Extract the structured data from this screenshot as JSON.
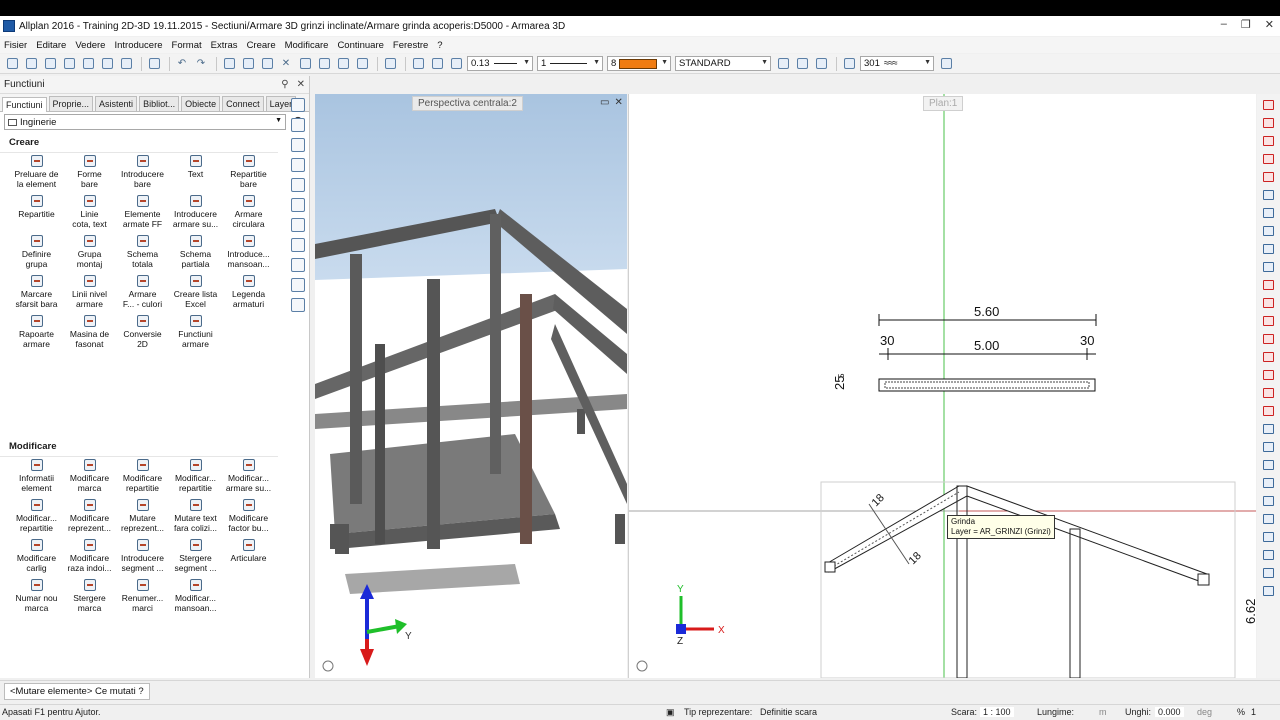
{
  "window": {
    "title": "Allplan 2016 - Training 2D-3D 19.11.2015 - Sectiuni/Armare 3D grinzi inclinate/Armare grinda acoperis:D5000 - Armarea 3D",
    "controls": [
      "–",
      "❐",
      "✕"
    ]
  },
  "menu": [
    "Fisier",
    "Editare",
    "Vedere",
    "Introducere",
    "Format",
    "Extras",
    "Creare",
    "Modificare",
    "Continuare",
    "Ferestre",
    "?"
  ],
  "toolbar": {
    "pen_value": "0.13",
    "line_value": "1",
    "color_value": "8",
    "color_hex": "#f07c12",
    "style_value": "STANDARD",
    "hatch_value": "301"
  },
  "panel": {
    "title": "Functiuni",
    "tabs": [
      "Functiuni",
      "Proprie...",
      "Asistenti",
      "Bibliot...",
      "Obiecte",
      "Connect",
      "Layer"
    ],
    "active_tab": "Functiuni",
    "category": "Inginerie",
    "create_group": {
      "title": "Creare",
      "items": [
        [
          "Preluare de",
          "la element"
        ],
        [
          "Forme",
          "bare"
        ],
        [
          "Introducere",
          "bare"
        ],
        [
          "Text",
          ""
        ],
        [
          "Repartitie",
          "bare"
        ],
        [
          "Repartitie",
          ""
        ],
        [
          "Linie",
          "cota, text"
        ],
        [
          "Elemente",
          "armate FF"
        ],
        [
          "Introducere",
          "armare su..."
        ],
        [
          "Armare",
          "circulara"
        ],
        [
          "Definire",
          "grupa"
        ],
        [
          "Grupa",
          "montaj"
        ],
        [
          "Schema",
          "totala"
        ],
        [
          "Schema",
          "partiala"
        ],
        [
          "Introduce...",
          "mansoan..."
        ],
        [
          "Marcare",
          "sfarsit bara"
        ],
        [
          "Linii nivel",
          "armare"
        ],
        [
          "Armare",
          "F... - culori"
        ],
        [
          "Creare lista",
          "Excel"
        ],
        [
          "Legenda",
          "armaturi"
        ],
        [
          "Rapoarte",
          "armare"
        ],
        [
          "Masina de",
          "fasonat"
        ],
        [
          "Conversie",
          "2D"
        ],
        [
          "Functiuni",
          "armare"
        ]
      ]
    },
    "modify_group": {
      "title": "Modificare",
      "items": [
        [
          "Informatii",
          "element"
        ],
        [
          "Modificare",
          "marca"
        ],
        [
          "Modificare",
          "repartitie"
        ],
        [
          "Modificar...",
          "repartitie"
        ],
        [
          "Modificar...",
          "armare su..."
        ],
        [
          "Modificar...",
          "repartitie"
        ],
        [
          "Modificare",
          "reprezent..."
        ],
        [
          "Mutare",
          "reprezent..."
        ],
        [
          "Mutare text",
          "fara colizi..."
        ],
        [
          "Modificare",
          "factor bu..."
        ],
        [
          "Modificare",
          "carlig"
        ],
        [
          "Modificare",
          "raza indoi..."
        ],
        [
          "Introducere",
          "segment ..."
        ],
        [
          "Stergere",
          "segment ..."
        ],
        [
          "Articulare",
          ""
        ],
        [
          "Numar nou",
          "marca"
        ],
        [
          "Stergere",
          "marca"
        ],
        [
          "Renumer...",
          "marci"
        ],
        [
          "Modificar...",
          "mansoan..."
        ]
      ]
    }
  },
  "viewport3d": {
    "label": "Perspectiva centrala:2",
    "axis_y": "Y"
  },
  "viewport2d": {
    "label": "Plan:1",
    "dim_total": "5.60",
    "dim_left": "30",
    "dim_mid": "5.00",
    "dim_right": "30",
    "dim_height": "25",
    "dim_height_sup": "5",
    "dim_side": "6.62",
    "tooltip_title": "Grinda",
    "tooltip_layer": "Layer = AR_GRINZI (Grinzi)",
    "label_18a": "18",
    "label_18b": "18",
    "axis_x": "X",
    "axis_y": "Y",
    "axis_z": "Z"
  },
  "command": "<Mutare elemente> Ce mutati ?",
  "status": {
    "help": "Apasati F1 pentru Ajutor.",
    "repr_label": "Tip reprezentare:",
    "repr_value": "Definitie scara",
    "scale_label": "Scara:",
    "scale_value": "1 : 100",
    "length_label": "Lungime:",
    "length_unit": "m",
    "angle_label": "Unghi:",
    "angle_value": "0.000",
    "angle_unit": "deg",
    "percent": "%",
    "percent_value": "1"
  }
}
